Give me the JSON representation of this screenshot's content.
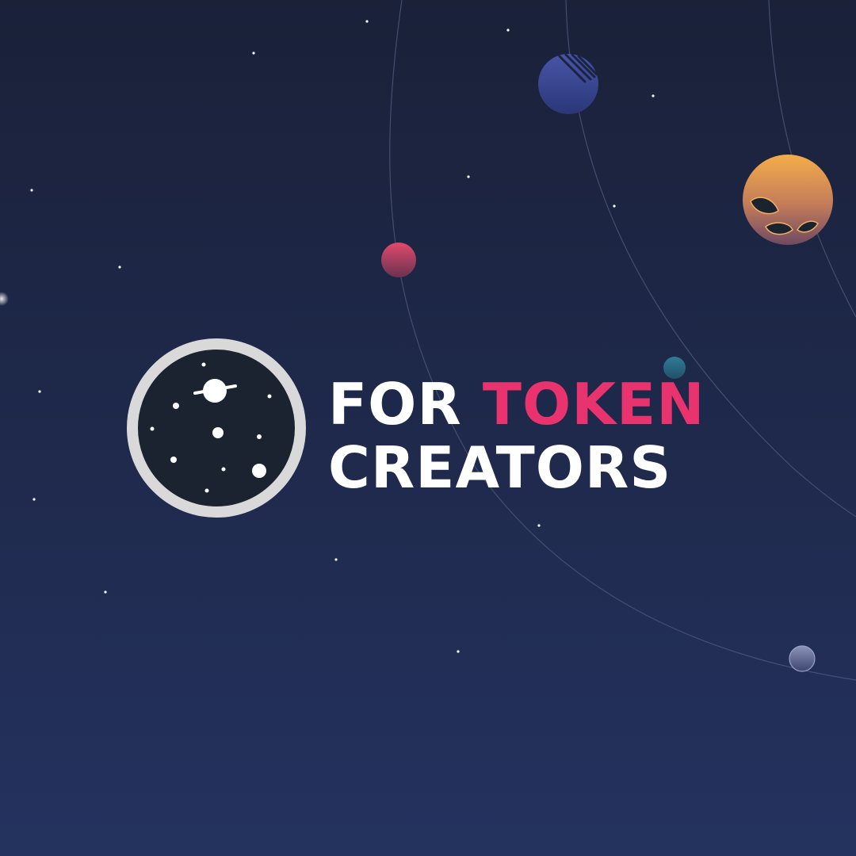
{
  "headline": {
    "line1_part1": "FOR",
    "line1_part2": "TOKEN",
    "line2": "CREATORS"
  },
  "colors": {
    "background_top": "#1a2139",
    "background_bottom": "#24325f",
    "accent": "#e8336f",
    "text": "#ffffff",
    "logo_ring": "#d9d9d9",
    "logo_fill": "#1b2330",
    "orbit_line": "#4a5578"
  },
  "icons": [
    "space-logo-icon",
    "blue-planet-icon",
    "orange-planet-icon",
    "pink-planet-icon",
    "teal-planet-icon",
    "grey-planet-icon",
    "star-icon"
  ]
}
